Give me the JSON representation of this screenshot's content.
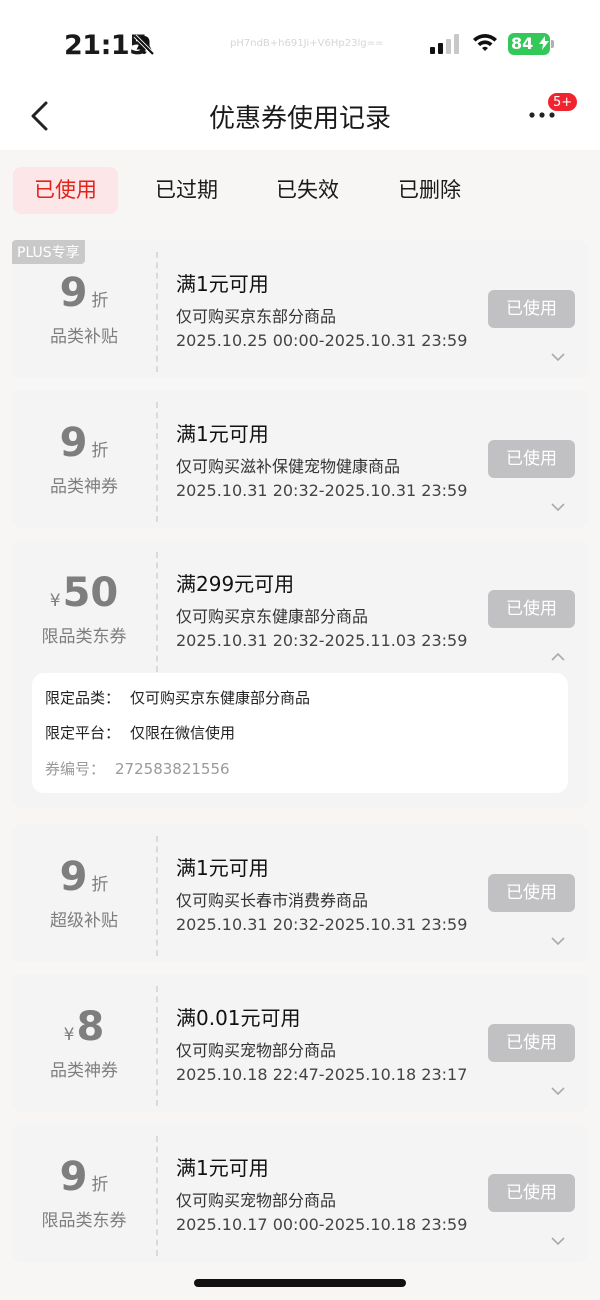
{
  "status_bar": {
    "time": "21:15",
    "center_text": "pH7ndB+h691Ji+V6Hp23lg==",
    "battery": "84",
    "icons": [
      "bell-slash-icon",
      "cell-signal-icon",
      "wifi-icon",
      "battery-charging-icon"
    ]
  },
  "header": {
    "title": "优惠券使用记录",
    "badge": "5+",
    "icons": [
      "back-arrow-icon",
      "more-dots-icon"
    ]
  },
  "tabs": [
    {
      "label": "已使用",
      "active": true
    },
    {
      "label": "已过期",
      "active": false
    },
    {
      "label": "已失效",
      "active": false
    },
    {
      "label": "已删除",
      "active": false
    }
  ],
  "coupons": [
    {
      "tag": "PLUS专享",
      "prefix": "",
      "amount": "9",
      "unit": "折",
      "type": "品类补贴",
      "title": "满1元可用",
      "desc": "仅可购买京东部分商品",
      "date": "2025.10.25 00:00-2025.10.31 23:59",
      "status": "已使用",
      "expanded": false
    },
    {
      "tag": "",
      "prefix": "",
      "amount": "9",
      "unit": "折",
      "type": "品类神券",
      "title": "满1元可用",
      "desc": "仅可购买滋补保健宠物健康商品",
      "date": "2025.10.31 20:32-2025.10.31 23:59",
      "status": "已使用",
      "expanded": false
    },
    {
      "tag": "",
      "prefix": "¥",
      "amount": "50",
      "unit": "",
      "type": "限品类东券",
      "title": "满299元可用",
      "desc": "仅可购买京东健康部分商品",
      "date": "2025.10.31 20:32-2025.11.03 23:59",
      "status": "已使用",
      "expanded": true,
      "details": {
        "category_label": "限定品类：",
        "category_value": "仅可购买京东健康部分商品",
        "platform_label": "限定平台：",
        "platform_value": "仅限在微信使用",
        "id_label": "券编号：",
        "id_value": "272583821556"
      }
    },
    {
      "tag": "",
      "prefix": "",
      "amount": "9",
      "unit": "折",
      "type": "超级补贴",
      "title": "满1元可用",
      "desc": "仅可购买长春市消费券商品",
      "date": "2025.10.31 20:32-2025.10.31 23:59",
      "status": "已使用",
      "expanded": false
    },
    {
      "tag": "",
      "prefix": "¥",
      "amount": "8",
      "unit": "",
      "type": "品类神券",
      "title": "满0.01元可用",
      "desc": "仅可购买宠物部分商品",
      "date": "2025.10.18 22:47-2025.10.18 23:17",
      "status": "已使用",
      "expanded": false
    },
    {
      "tag": "",
      "prefix": "",
      "amount": "9",
      "unit": "折",
      "type": "限品类东券",
      "title": "满1元可用",
      "desc": "仅可购买宠物部分商品",
      "date": "2025.10.17 00:00-2025.10.18 23:59",
      "status": "已使用",
      "expanded": false
    }
  ],
  "colors": {
    "accent_red": "#e2231a",
    "active_tab_bg": "#fde6e8",
    "used_button": "#c1c1c3",
    "battery_green": "#34c759",
    "badge_red": "#f0232f"
  }
}
